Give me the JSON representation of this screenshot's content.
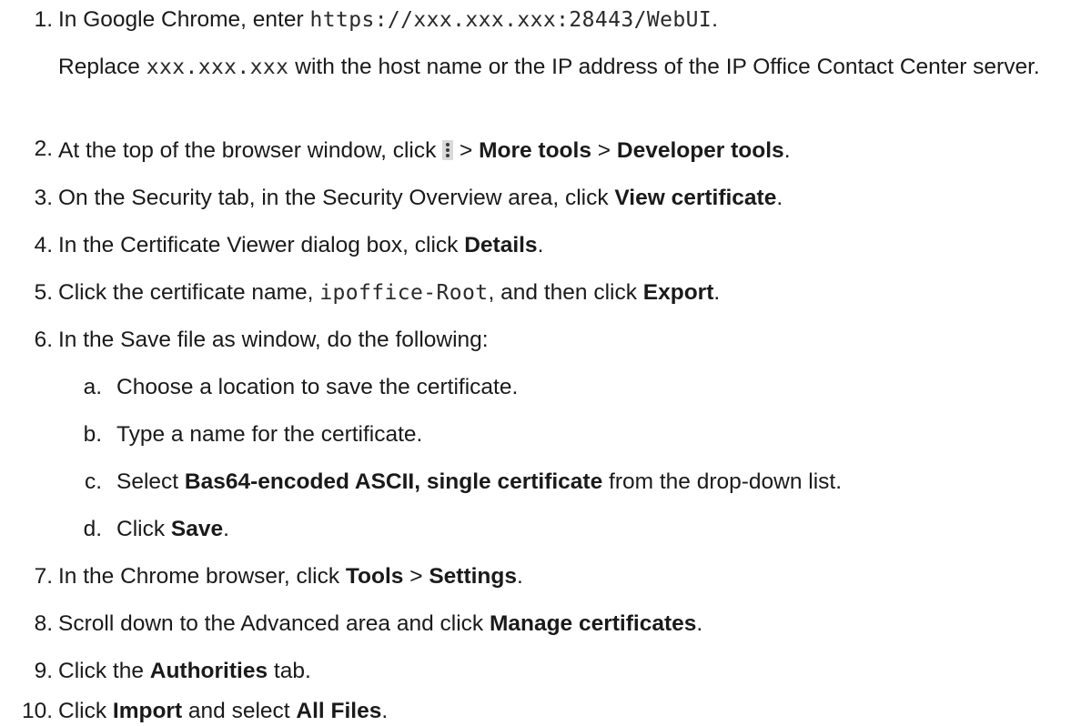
{
  "steps": [
    {
      "num": "1.",
      "prefix": "In Google Chrome, enter ",
      "url": "https://xxx.xxx.xxx:28443/WebUI",
      "suffix": ".",
      "note_prefix": "Replace ",
      "note_code": "xxx.xxx.xxx",
      "note_suffix": " with the host name or the IP address of the IP Office Contact Center server."
    },
    {
      "num": "2.",
      "prefix": "At the top of the browser window, click ",
      "icon": "more-vert-icon",
      "sep1": " > ",
      "bold1": "More tools",
      "sep2": " > ",
      "bold2": "Developer tools",
      "suffix": "."
    },
    {
      "num": "3.",
      "prefix": "On the Security tab, in the Security Overview area, click ",
      "bold1": "View certificate",
      "suffix": "."
    },
    {
      "num": "4.",
      "prefix": "In the Certificate Viewer dialog box, click ",
      "bold1": "Details",
      "suffix": "."
    },
    {
      "num": "5.",
      "prefix": "Click the certificate name, ",
      "code": "ipoffice-Root",
      "middle": ", and then click ",
      "bold1": "Export",
      "suffix": "."
    },
    {
      "num": "6.",
      "text": "In the Save file as window, do the following:",
      "substeps": [
        {
          "num": "a.",
          "text": "Choose a location to save the certificate."
        },
        {
          "num": "b.",
          "text": "Type a name for the certificate."
        },
        {
          "num": "c.",
          "prefix": "Select ",
          "bold": "Bas64-encoded ASCII, single certificate",
          "suffix": " from the drop-down list."
        },
        {
          "num": "d.",
          "prefix": "Click ",
          "bold": "Save",
          "suffix": "."
        }
      ]
    },
    {
      "num": "7.",
      "prefix": "In the Chrome browser, click ",
      "bold1": "Tools",
      "sep1": " > ",
      "bold2": "Settings",
      "suffix": "."
    },
    {
      "num": "8.",
      "prefix": "Scroll down to the Advanced area and click ",
      "bold1": "Manage certificates",
      "suffix": "."
    },
    {
      "num": "9.",
      "prefix": "Click the ",
      "bold1": "Authorities",
      "suffix": " tab."
    },
    {
      "num": "10.",
      "prefix": "Click ",
      "bold1": "Import",
      "middle": " and select ",
      "bold2": "All Files",
      "suffix": "."
    }
  ]
}
